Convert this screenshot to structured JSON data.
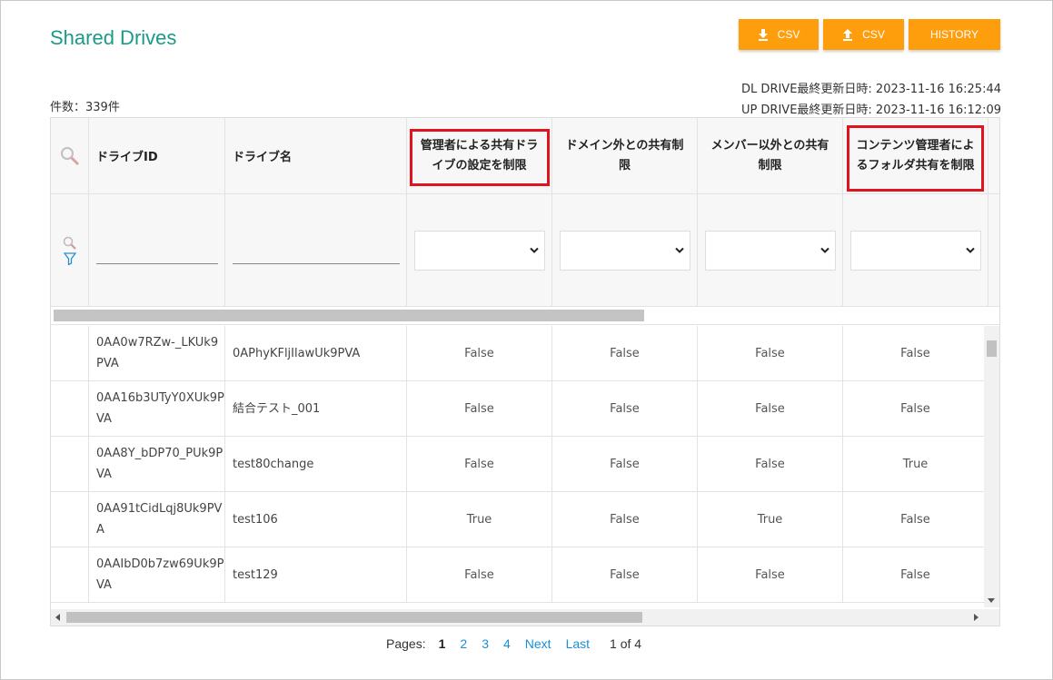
{
  "page": {
    "title": "Shared Drives"
  },
  "toolbar": {
    "download_csv_label": "CSV",
    "upload_csv_label": "CSV",
    "history_label": "HISTORY",
    "accent_color": "#ff9e0d"
  },
  "info": {
    "count": "件数：339件",
    "dl_updated": "DL DRIVE最終更新日時: 2023-11-16 16:25:44",
    "up_updated": "UP DRIVE最終更新日時: 2023-11-16 16:12:09"
  },
  "table": {
    "headers": {
      "drive_id": "ドライブID",
      "drive_name": "ドライブ名",
      "admin_restrict": "管理者による共有ドライブの設定を制限",
      "domain_restrict": "ドメイン外との共有制限",
      "member_restrict": "メンバー以外との共有制限",
      "content_restrict": "コンテンツ管理者によるフォルダ共有を制限"
    },
    "rows": [
      {
        "id": "0AA0w7RZw-_LKUk9PVA",
        "name": "0APhyKFljIlawUk9PVA",
        "admin": "False",
        "domain": "False",
        "member": "False",
        "content": "False"
      },
      {
        "id": "0AA16b3UTyY0XUk9PVA",
        "name": "結合テスト_001",
        "admin": "False",
        "domain": "False",
        "member": "False",
        "content": "False"
      },
      {
        "id": "0AA8Y_bDP70_PUk9PVA",
        "name": "test80change",
        "admin": "False",
        "domain": "False",
        "member": "False",
        "content": "True"
      },
      {
        "id": "0AA91tCidLqj8Uk9PVA",
        "name": "test106",
        "admin": "True",
        "domain": "False",
        "member": "True",
        "content": "False"
      },
      {
        "id": "0AAIbD0b7zw69Uk9PVA",
        "name": "test129",
        "admin": "False",
        "domain": "False",
        "member": "False",
        "content": "False"
      }
    ]
  },
  "pagination": {
    "label": "Pages:",
    "pages": [
      "1",
      "2",
      "3",
      "4"
    ],
    "next": "Next",
    "last": "Last",
    "status": "1 of 4"
  },
  "icons": {
    "download": "download-icon",
    "upload": "upload-icon",
    "search": "search-icon",
    "filter": "filter-icon",
    "chevron": "chevron-down-icon"
  },
  "colors": {
    "title": "#1a9a8a",
    "highlight_box": "#e0141e",
    "link": "#1a8fd6"
  }
}
